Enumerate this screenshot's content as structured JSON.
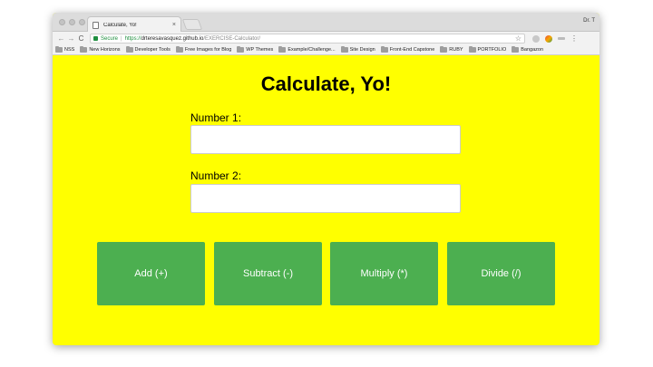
{
  "browser": {
    "tab_title": "Calculate, Yo!",
    "tab_close": "×",
    "profile_name": "Dr. T",
    "nav": {
      "back": "←",
      "forward": "→",
      "reload": "C"
    },
    "address": {
      "secure_label": "Secure",
      "separator": "|",
      "scheme": "https://",
      "host": "drteresavasquez.github.io",
      "path": "/EXERCISE-Calculator/"
    },
    "star": "☆",
    "menu": "⋮",
    "bookmarks": [
      "NSS",
      "New Horizons",
      "Developer Tools",
      "Free Images for Blog",
      "WP Themes",
      "Example/Challenge...",
      "Site Design",
      "Front-End Capstone",
      "RUBY",
      "PORTFOLIO",
      "Bangazon"
    ]
  },
  "page": {
    "title": "Calculate, Yo!",
    "number1_label": "Number 1:",
    "number1_value": "",
    "number2_label": "Number 2:",
    "number2_value": "",
    "buttons": {
      "add": "Add (+)",
      "subtract": "Subtract (-)",
      "multiply": "Multiply (*)",
      "divide": "Divide (/)"
    },
    "colors": {
      "background": "#ffff00",
      "button": "#4caf50",
      "button_text": "#ffffff"
    }
  }
}
